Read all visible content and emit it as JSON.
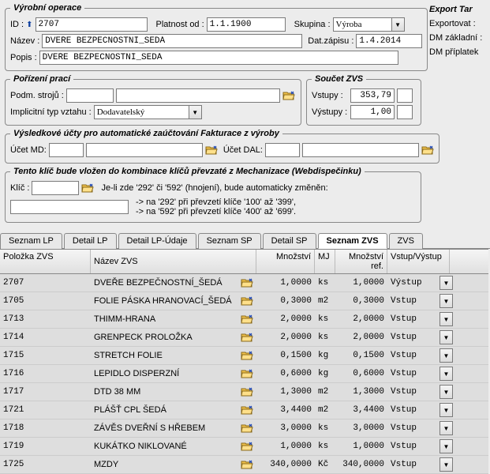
{
  "header": {
    "group_title": "Výrobní operace",
    "id_label": "ID :",
    "id_value": "2707",
    "platnost_label": "Platnost od :",
    "platnost_value": "1.1.1900",
    "skupina_label": "Skupina :",
    "skupina_value": "Výroba",
    "nazev_label": "Název :",
    "nazev_value": "DVEŘE BEZPEČNOSTNÍ_ŠEDÁ",
    "datzap_label": "Dat.zápisu :",
    "datzap_value": "1.4.2014",
    "popis_label": "Popis :",
    "popis_value": "DVEŘE BEZPEČNOSTNÍ_ŠEDÁ"
  },
  "porizeni": {
    "title": "Pořízení prací",
    "podm_label": "Podm. strojů :",
    "impl_label": "Implicitní typ vztahu :",
    "impl_value": "Dodavatelský"
  },
  "soucet": {
    "title": "Součet ZVS",
    "vstupy_label": "Vstupy :",
    "vstupy_value": "353,79",
    "vystupy_label": "Výstupy :",
    "vystupy_value": "1,00"
  },
  "ucty": {
    "title": "Výsledkové účty pro automatické zaúčtování Fakturace z výroby",
    "md_label": "Účet MD:",
    "dal_label": "Účet DAL:"
  },
  "klic": {
    "title": "Tento klíč bude vložen do kombinace klíčů převzaté z Mechanizace (Webdispečinku)",
    "klic_label": "Klíč :",
    "note1": "Je-li zde '292' či '592' (hnojení), bude automaticky změněn:",
    "note2": "-> na '292' při převzetí klíče '100' až '399',",
    "note3": "-> na '592' při převzetí klíče '400' až '699'."
  },
  "side": {
    "title": "Export Tar",
    "exportovat": "Exportovat :",
    "dm_zakl": "DM základní :",
    "dm_pripl": "DM příplatek"
  },
  "tabs": [
    "Seznam LP",
    "Detail LP",
    "Detail LP-Údaje",
    "Seznam SP",
    "Detail SP",
    "Seznam ZVS",
    "ZVS"
  ],
  "tabs_active": 5,
  "grid": {
    "headers": [
      "Položka ZVS",
      "Název ZVS",
      "Množství",
      "MJ",
      "Množství ref.",
      "Vstup/Výstup"
    ],
    "rows": [
      {
        "pol": "2707",
        "naz": "DVEŘE BEZPEČNOSTNÍ_ŠEDÁ",
        "mn": "1,0000",
        "mj": "ks",
        "mr": "1,0000",
        "vv": "Výstup"
      },
      {
        "pol": "1705",
        "naz": "FOLIE PÁSKA HRANOVACÍ_ŠEDÁ",
        "mn": "0,3000",
        "mj": "m2",
        "mr": "0,3000",
        "vv": "Vstup"
      },
      {
        "pol": "1713",
        "naz": "THIMM-HRANA",
        "mn": "2,0000",
        "mj": "ks",
        "mr": "2,0000",
        "vv": "Vstup"
      },
      {
        "pol": "1714",
        "naz": "GRENPECK PROLOŽKA",
        "mn": "2,0000",
        "mj": "ks",
        "mr": "2,0000",
        "vv": "Vstup"
      },
      {
        "pol": "1715",
        "naz": "STRETCH FOLIE",
        "mn": "0,1500",
        "mj": "kg",
        "mr": "0,1500",
        "vv": "Vstup"
      },
      {
        "pol": "1716",
        "naz": "LEPIDLO DISPERZNÍ",
        "mn": "0,6000",
        "mj": "kg",
        "mr": "0,6000",
        "vv": "Vstup"
      },
      {
        "pol": "1717",
        "naz": "DTD 38 MM",
        "mn": "1,3000",
        "mj": "m2",
        "mr": "1,3000",
        "vv": "Vstup"
      },
      {
        "pol": "1721",
        "naz": "PLÁŠŤ CPL ŠEDÁ",
        "mn": "3,4400",
        "mj": "m2",
        "mr": "3,4400",
        "vv": "Vstup"
      },
      {
        "pol": "1718",
        "naz": "ZÁVĚS DVEŘNÍ S HŘEBEM",
        "mn": "3,0000",
        "mj": "ks",
        "mr": "3,0000",
        "vv": "Vstup"
      },
      {
        "pol": "1719",
        "naz": "KUKÁTKO NIKLOVANÉ",
        "mn": "1,0000",
        "mj": "ks",
        "mr": "1,0000",
        "vv": "Vstup"
      },
      {
        "pol": "1725",
        "naz": "MZDY",
        "mn": "340,0000",
        "mj": "Kč",
        "mr": "340,0000",
        "vv": "Vstup"
      }
    ]
  }
}
